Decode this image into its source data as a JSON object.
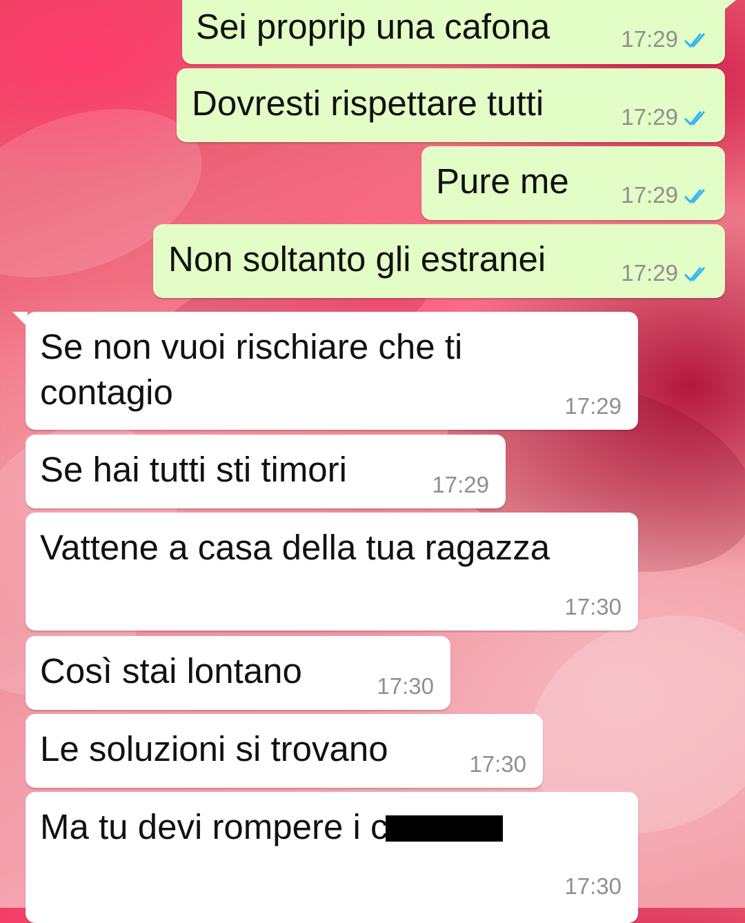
{
  "messages": [
    {
      "dir": "out",
      "text": "Sei proprip una cafona",
      "time": "17:29",
      "read": true
    },
    {
      "dir": "out",
      "text": "Dovresti rispettare tutti",
      "time": "17:29",
      "read": true
    },
    {
      "dir": "out",
      "text": "Pure me",
      "time": "17:29",
      "read": true
    },
    {
      "dir": "out",
      "text": "Non soltanto gli estranei",
      "time": "17:29",
      "read": true
    },
    {
      "dir": "in",
      "text": "Se non vuoi rischiare che ti contagio",
      "time": "17:29"
    },
    {
      "dir": "in",
      "text": "Se hai tutti sti timori",
      "time": "17:29"
    },
    {
      "dir": "in",
      "text": "Vattene a casa della tua ragazza",
      "time": "17:30"
    },
    {
      "dir": "in",
      "text": "Così stai lontano",
      "time": "17:30"
    },
    {
      "dir": "in",
      "text": "Le soluzioni si trovano",
      "time": "17:30"
    },
    {
      "dir": "in",
      "text": "Ma tu devi rompere i c",
      "redacted": true,
      "time": "17:30"
    }
  ],
  "colors": {
    "outgoing_bubble": "#e2fdc6",
    "incoming_bubble": "#ffffff",
    "read_ticks": "#34b7f1",
    "timestamp": "#8f8f8f"
  },
  "icons": {
    "read_receipt": "double-check-icon"
  }
}
